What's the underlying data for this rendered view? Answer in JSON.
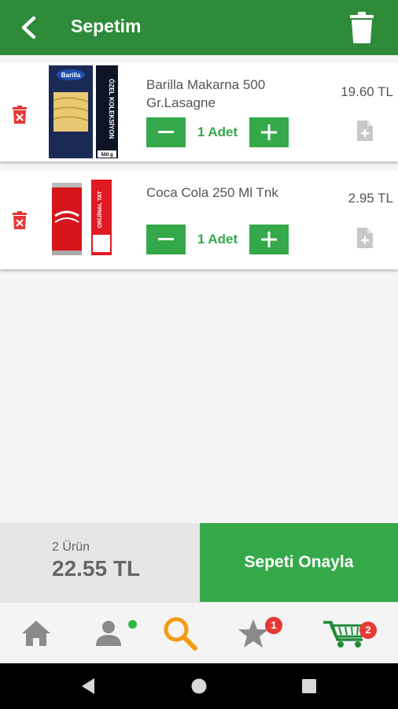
{
  "header": {
    "title": "Sepetim"
  },
  "cart_items": [
    {
      "name": "Barilla Makarna 500 Gr.Lasagne",
      "price": "19.60 TL",
      "quantity_label": "1 Adet",
      "image_icon": "pasta-box-image",
      "box_brand_text": "Barilla",
      "box_side_text": "ÖZEL KOLEKSİYON",
      "box_weight_text": "500 g"
    },
    {
      "name": "Coca Cola 250 Ml Tnk",
      "price": "2.95 TL",
      "quantity_label": "1 Adet",
      "image_icon": "soda-can-image",
      "can_side_text": "ORİJİNAL TAT"
    }
  ],
  "summary": {
    "count": "2 Ürün",
    "total": "22.55 TL"
  },
  "confirm_button": {
    "label": "Sepeti Onayla"
  },
  "tabbar": {
    "items": [
      {
        "icon": "home-icon"
      },
      {
        "icon": "profile-icon",
        "status_dot": true
      },
      {
        "icon": "search-icon",
        "active": true
      },
      {
        "icon": "star-icon",
        "badge": "1"
      },
      {
        "icon": "cart-icon",
        "badge": "2"
      }
    ]
  },
  "colors": {
    "primary": "#2e8b3a",
    "accent": "#35a94a",
    "delete": "#e53935",
    "search_active": "#f39c12"
  }
}
